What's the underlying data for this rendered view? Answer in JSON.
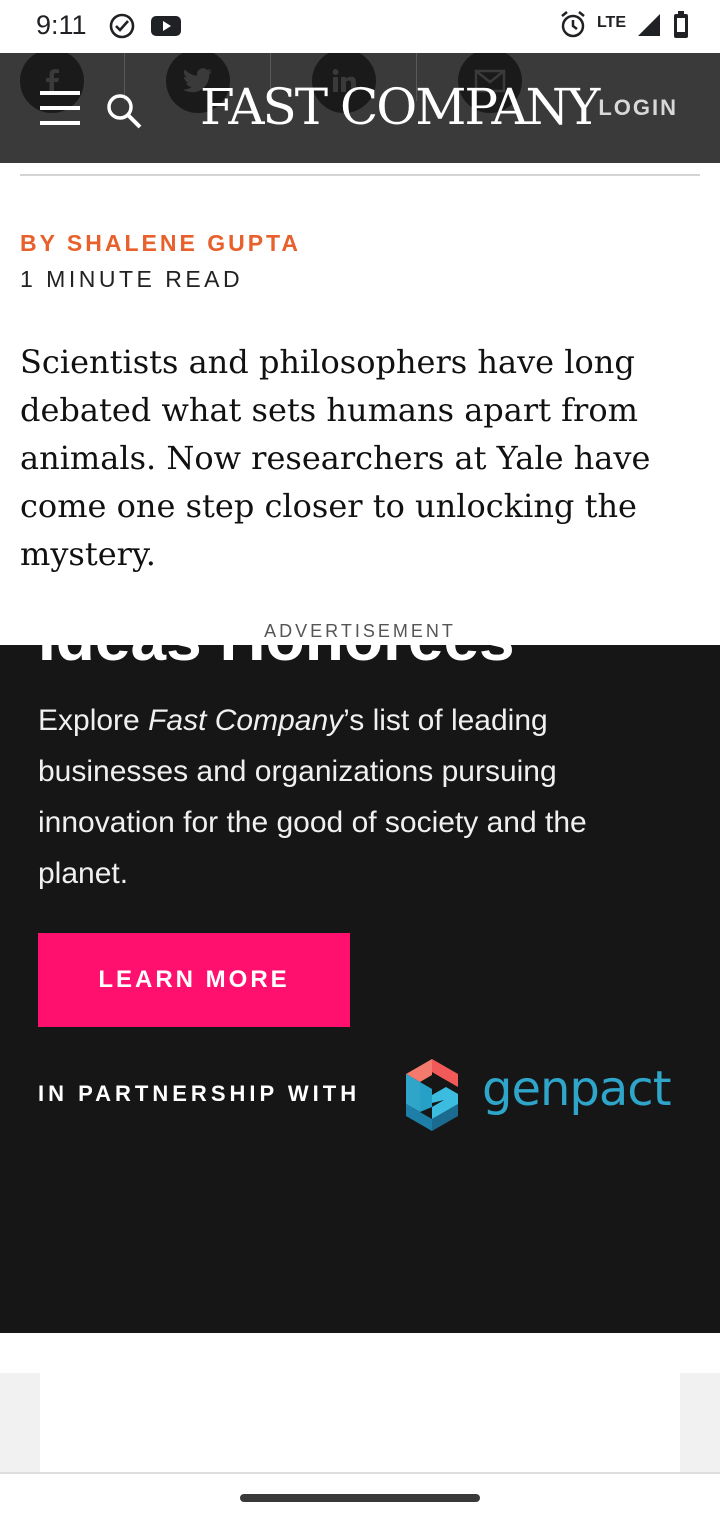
{
  "status": {
    "time": "9:11",
    "network": "LTE",
    "icons": [
      "check-circle-icon",
      "youtube-icon",
      "alarm-icon",
      "signal-icon",
      "battery-icon"
    ]
  },
  "header": {
    "logo_text": "FAST COMPANY",
    "login_label": "LOGIN",
    "share_icons": [
      "facebook-icon",
      "twitter-icon",
      "linkedin-icon",
      "email-icon"
    ]
  },
  "article": {
    "byline": "BY SHALENE GUPTA",
    "read_time": "1 MINUTE READ",
    "lede": "Scientists and philosophers have long debated what sets humans apart from animals. Now researchers at Yale have come one step closer to unlocking the mystery."
  },
  "ad": {
    "label": "ADVERTISEMENT",
    "headline_partial": "Ideas Honorees",
    "body_prefix": "Explore ",
    "body_italic": "Fast Company",
    "body_suffix": "’s list of leading businesses and organizations pursuing innovation for the good of society and the planet.",
    "button_label": "LEARN MORE",
    "partner_label": "IN PARTNERSHIP WITH",
    "partner_name": "genpact"
  },
  "colors": {
    "header_bg": "#3a3a3a",
    "byline": "#e8602c",
    "ad_bg": "#161616",
    "ad_button": "#ff0f6e",
    "genpact": "#2ea5c9"
  }
}
